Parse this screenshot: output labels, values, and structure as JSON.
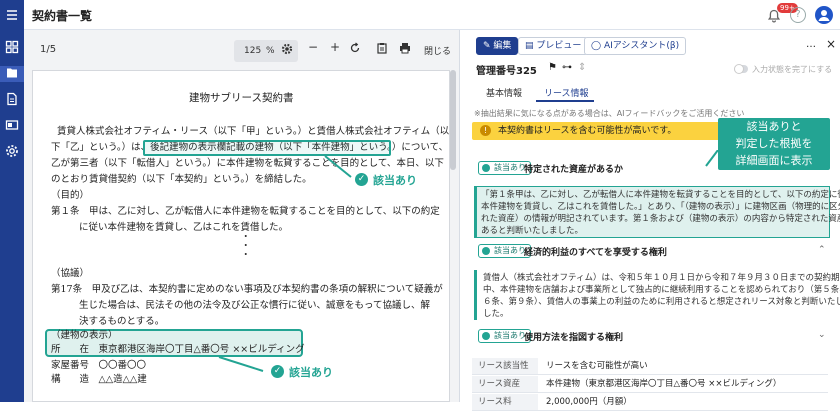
{
  "app": {
    "title": "契約書一覧",
    "notif_badge": "99+",
    "help": "?"
  },
  "viewer": {
    "page_indicator": "1/5",
    "zoom_value": "125",
    "zoom_unit": "%",
    "close_label": "閉じる",
    "doc": {
      "title": "建物サブリース契約書",
      "lines": [
        "賃貸人株式会社オフティム・リース（以下「甲」という。）と賃借人株式会社オフティム（以",
        "下「乙」という。）は、後記建物の表示欄記載の建物（以下「本件建物」という。）について、",
        "乙が第三者（以下「転借人」という。）に本件建物を転貸することを目的として、本日、以下",
        "のとおり賃貸借契約（以下「本契約」という。）を締結した。",
        "（目的）",
        "第１条　甲は、乙に対し、乙が転借人に本件建物を転貸することを目的として、以下の約定",
        "に従い本件建物を賃貸し、乙はこれを賃借した。",
        "（協議）",
        "第17条　甲及び乙は、本契約書に定めのない事項及び本契約書の条項の解釈について疑義が",
        "生じた場合は、民法その他の法令及び公正な慣行に従い、誠意をもって協議し、解",
        "決するものとする。",
        "（建物の表示）",
        "所　　在　東京都港区海岸〇丁目△番〇号 ××ビルディング",
        "家屋番号　〇〇番〇〇",
        "構　　造　△△造△△建"
      ],
      "mark_label": "該当あり"
    }
  },
  "panel": {
    "edit_label": "編集",
    "preview_label": "プレビュー",
    "ai_label": "AIアシスタント(β)",
    "more": "…",
    "close": "×",
    "mgmt_no": "管理番号325",
    "toggle_label": "入力状態を完了にする",
    "tabs": [
      "基本情報",
      "リース情報"
    ],
    "feedback_note": "※抽出結果に気になる点がある場合は、AIフィードバックをご活用ください",
    "feedback_link": "AIフィードバック",
    "notice": "本契約書はリースを含む可能性が高いです。",
    "callout": [
      "該当ありと",
      "判定した根拠を",
      "詳細画面に表示"
    ],
    "sections": [
      {
        "badge": "該当あり",
        "title": "特定された資産があるか",
        "quote": [
          "「第１条甲は、乙に対し、乙が転借人に本件建物を転貸することを目的として、以下の約定に従い",
          "本件建物を賃貸し、乙はこれを賃借した。」とあり、「（建物の表示）」に建物区画（物理的に区分さ",
          "れた資産）の情報が明記されています。第１条および（建物の表示）の内容から特定された資産が",
          "あると判断いたしました。"
        ]
      },
      {
        "badge": "該当あり",
        "title": "経済的利益のすべてを享受する権利",
        "quote": [
          "賃借人（株式会社オフティム）は、令和５年１０月１日から令和７年９月３０日までの契約期間",
          "中、本件建物を店舗および事業所として独占的に継続利用することを認められており（第５条、第",
          "６条、第９条）、賃借人の事業上の利益のために利用されると想定されリース対象と判断いたしま",
          "した。"
        ]
      },
      {
        "badge": "該当あり",
        "title": "使用方法を指図する権利"
      }
    ],
    "table": [
      {
        "k": "リース該当性",
        "v": "リースを含む可能性が高い"
      },
      {
        "k": "リース資産",
        "v": "本件建物（東京都港区海岸〇丁目△番〇号 ××ビルディング）"
      },
      {
        "k": "リース料",
        "v": "2,000,000円（月額）"
      }
    ]
  }
}
